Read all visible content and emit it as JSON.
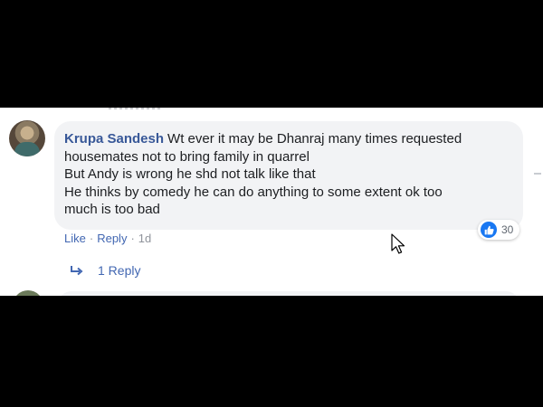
{
  "comment": {
    "author": "Krupa Sandesh",
    "text_lines": [
      "Wt ever it may be Dhanraj many times requested",
      "housemates not to bring family in quarrel",
      "But Andy is wrong he shd not talk like that",
      "He thinks by comedy he can do anything to some extent ok too",
      "much is too bad"
    ],
    "reaction_count": "30",
    "actions": {
      "like": "Like",
      "reply": "Reply",
      "time": "1d"
    },
    "replies_label": "1 Reply"
  },
  "colors": {
    "author": "#385898",
    "link": "#4267b2",
    "bubble": "#f2f3f5",
    "like_badge": "#1877f2"
  },
  "icons": {
    "reaction": "thumbs-up-icon",
    "reply": "reply-arrow-icon",
    "cursor": "mouse-cursor-icon"
  }
}
